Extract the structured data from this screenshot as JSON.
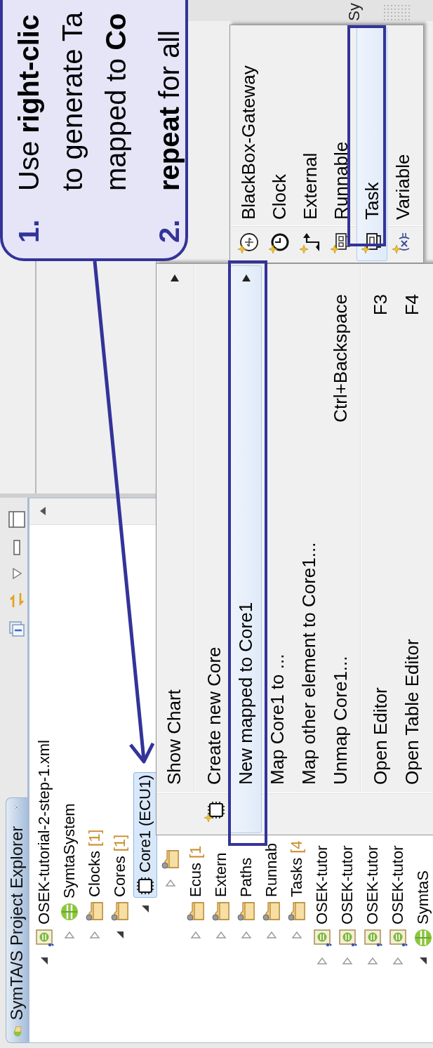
{
  "explorer": {
    "title": "SymTA/S Project Explorer",
    "tree": [
      {
        "label": "OSEK-tutorial-2-step-1.xml",
        "kind": "file",
        "expanded": true,
        "selected": false,
        "children": [
          {
            "label": "SymtaSystem",
            "kind": "system",
            "expanded": false,
            "selected": false
          },
          {
            "label": "Clocks",
            "count": "[1]",
            "kind": "folder",
            "expanded": false,
            "selected": false
          },
          {
            "label": "Cores",
            "count": "[1]",
            "kind": "folder",
            "expanded": true,
            "selected": false,
            "children": [
              {
                "label": "Core1 (ECU1)",
                "kind": "core",
                "expanded": true,
                "selected": true,
                "children": [
                  {
                    "kind": "folder",
                    "expanded": false,
                    "selected": false
                  }
                ]
              }
            ]
          },
          {
            "label": "Ecus",
            "count": "[1",
            "kind": "folder",
            "expanded": false,
            "selected": false
          },
          {
            "label": "Extern",
            "kind": "folder",
            "expanded": false,
            "selected": false
          },
          {
            "label": "Paths",
            "kind": "folder",
            "expanded": false,
            "selected": false
          },
          {
            "label": "Runnab",
            "kind": "folder",
            "expanded": false,
            "selected": false
          },
          {
            "label": "Tasks",
            "count": "[4",
            "kind": "folder",
            "expanded": false,
            "selected": false
          }
        ]
      },
      {
        "label": "OSEK-tutor",
        "kind": "file",
        "expanded": false,
        "selected": false
      },
      {
        "label": "OSEK-tutor",
        "kind": "file",
        "expanded": false,
        "selected": false
      },
      {
        "label": "OSEK-tutor",
        "kind": "file",
        "expanded": false,
        "selected": false
      },
      {
        "label": "OSEK-tutor",
        "kind": "file",
        "expanded": false,
        "selected": false
      },
      {
        "label": "SymtaS",
        "kind": "system",
        "expanded": true,
        "selected": false
      }
    ]
  },
  "context_menu": {
    "items": [
      {
        "kind": "item",
        "label": "Show Chart",
        "submenu": true,
        "selected": false
      },
      {
        "kind": "separator"
      },
      {
        "kind": "new-item",
        "label": "Create new Core",
        "submenu": false,
        "selected": false
      },
      {
        "kind": "item",
        "label": "New mapped to Core1",
        "submenu": true,
        "selected": true
      },
      {
        "kind": "item",
        "label": "Map Core1 to ...",
        "submenu": false,
        "selected": false
      },
      {
        "kind": "item",
        "label": "Map other element to Core1...",
        "submenu": false,
        "selected": false
      },
      {
        "kind": "item",
        "label": "Unmap Core1...",
        "shortcut": "Ctrl+Backspace",
        "submenu": false,
        "selected": false
      },
      {
        "kind": "separator"
      },
      {
        "kind": "item",
        "label": "Open Editor",
        "shortcut": "F3",
        "submenu": false,
        "selected": false
      },
      {
        "kind": "item",
        "label": "Open Table Editor",
        "shortcut": "F4",
        "submenu": false,
        "selected": false
      }
    ]
  },
  "submenu": {
    "items": [
      {
        "label": "BlackBox-Gateway",
        "kind": "gateway",
        "selected": false
      },
      {
        "label": "Clock",
        "kind": "clock",
        "selected": false
      },
      {
        "label": "External",
        "kind": "external",
        "selected": false
      },
      {
        "label": "Runnable",
        "kind": "runnable",
        "selected": false
      },
      {
        "label": "Task",
        "kind": "task",
        "selected": true
      },
      {
        "label": "Variable",
        "kind": "variable",
        "selected": false
      }
    ]
  },
  "editor": {
    "text_1": "Sy"
  },
  "callout": {
    "steps": [
      {
        "number": "1.",
        "lines": [
          "Use **right-clic**",
          "to generate Ta",
          "mapped to **Co**"
        ]
      },
      {
        "number": "2.",
        "lines": [
          "**repeat** for all"
        ]
      }
    ]
  }
}
